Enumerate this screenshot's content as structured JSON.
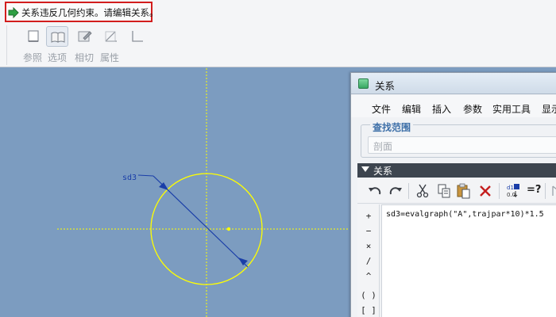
{
  "message": {
    "text": "关系违反几何约束。请编辑关系。",
    "icon": "green-arrow-icon",
    "highlight_color": "#d21d1d"
  },
  "toolbar": {
    "items": [
      {
        "name": "references",
        "icon": "square-icon",
        "label": "参照"
      },
      {
        "name": "options",
        "icon": "open-book-icon",
        "label": "选项"
      },
      {
        "name": "tangent",
        "icon": "edit-square-icon",
        "label": "相切"
      },
      {
        "name": "properties",
        "icon": "angle-icon",
        "label": "属性"
      }
    ]
  },
  "canvas": {
    "background": "#7c9cc0",
    "sketch_color": "#ffff00",
    "dimension_color": "#1a3ea8",
    "dimension_label": "sd3"
  },
  "dialog": {
    "title": "关系",
    "menu": [
      "文件",
      "编辑",
      "插入",
      "参数",
      "实用工具",
      "显示"
    ],
    "find_scope": {
      "label": "查找范围",
      "value": "剖面"
    },
    "relations": {
      "header": "关系",
      "toolbar_icons": [
        "undo-icon",
        "redo-icon",
        "cut-icon",
        "copy-icon",
        "paste-icon",
        "delete-icon",
        "sort-icon",
        "evaluate-icon"
      ],
      "evaluate_label": "=?",
      "operators": [
        "+",
        "−",
        "×",
        "/",
        "^",
        "( )",
        "[ ]"
      ],
      "text": "sd3=evalgraph(\"A\",trajpar*10)*1.5"
    }
  }
}
